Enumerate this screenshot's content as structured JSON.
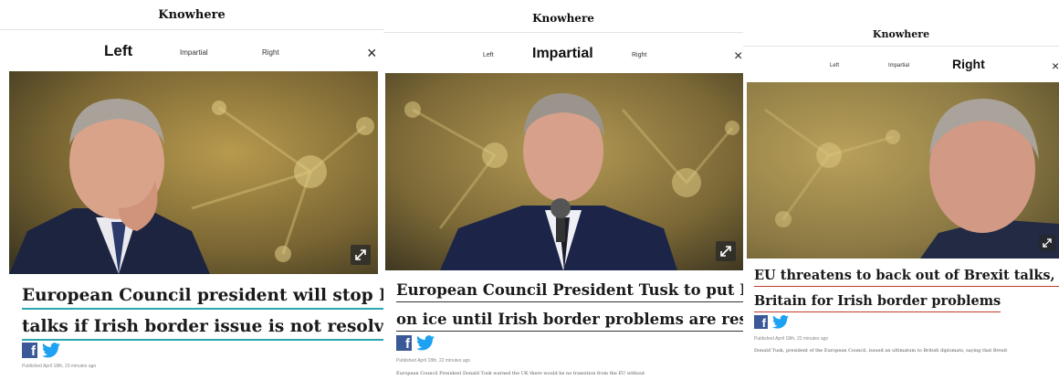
{
  "panels": [
    {
      "brand": "Knowhere",
      "tabs": {
        "left": "Left",
        "impartial": "Impartial",
        "right": "Right",
        "active": "left"
      },
      "close": "×",
      "headline_lines": [
        "European Council president will stop Brexit",
        "talks if Irish border issue is not resolved"
      ],
      "underline_color": "#2aa7b0",
      "published": "Published April 18th, 23 minutes ago",
      "body": ""
    },
    {
      "brand": "Knowhere",
      "tabs": {
        "left": "Left",
        "impartial": "Impartial",
        "right": "Right",
        "active": "impartial"
      },
      "close": "×",
      "headline_lines": [
        "European Council President Tusk to put Brexit",
        "on ice until Irish border problems are resolved"
      ],
      "underline_color": "#333333",
      "published": "Published April 18th, 22 minutes ago",
      "body": "European Council President Donald Tusk warned the UK there would be no transition from the EU without"
    },
    {
      "brand": "Knowhere",
      "tabs": {
        "left": "Left",
        "impartial": "Impartial",
        "right": "Right",
        "active": "right"
      },
      "close": "×",
      "headline_lines": [
        "EU threatens to back out of Brexit talks, blames",
        "Britain for Irish border problems"
      ],
      "underline_color": "#c0392b",
      "published": "Published April 18th, 22 minutes ago",
      "body": "Donald Tusk, president of the European Council, issued an ultimatum to British diplomats, saying that Brexit"
    }
  ],
  "colors": {
    "facebook": "#3b5998",
    "twitter": "#1da1f2"
  },
  "icons": [
    "facebook-icon",
    "twitter-icon",
    "expand-icon",
    "close-icon"
  ]
}
